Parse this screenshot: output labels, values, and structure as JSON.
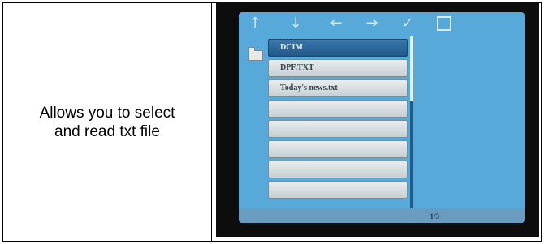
{
  "description_cell": {
    "text": "Allows you to select and read txt file"
  },
  "device_screen": {
    "toolbar": {
      "up_icon": "↑",
      "down_icon": "↓",
      "left_icon": "←",
      "right_icon": "→",
      "confirm_icon": "✓"
    },
    "files": [
      {
        "name": "DCIM",
        "selected": true
      },
      {
        "name": "DPF.TXT",
        "selected": false
      },
      {
        "name": "Today's news.txt",
        "selected": false
      },
      {
        "name": "",
        "selected": false
      },
      {
        "name": "",
        "selected": false
      },
      {
        "name": "",
        "selected": false
      },
      {
        "name": "",
        "selected": false
      },
      {
        "name": "",
        "selected": false
      }
    ],
    "page_indicator": "1/3"
  }
}
